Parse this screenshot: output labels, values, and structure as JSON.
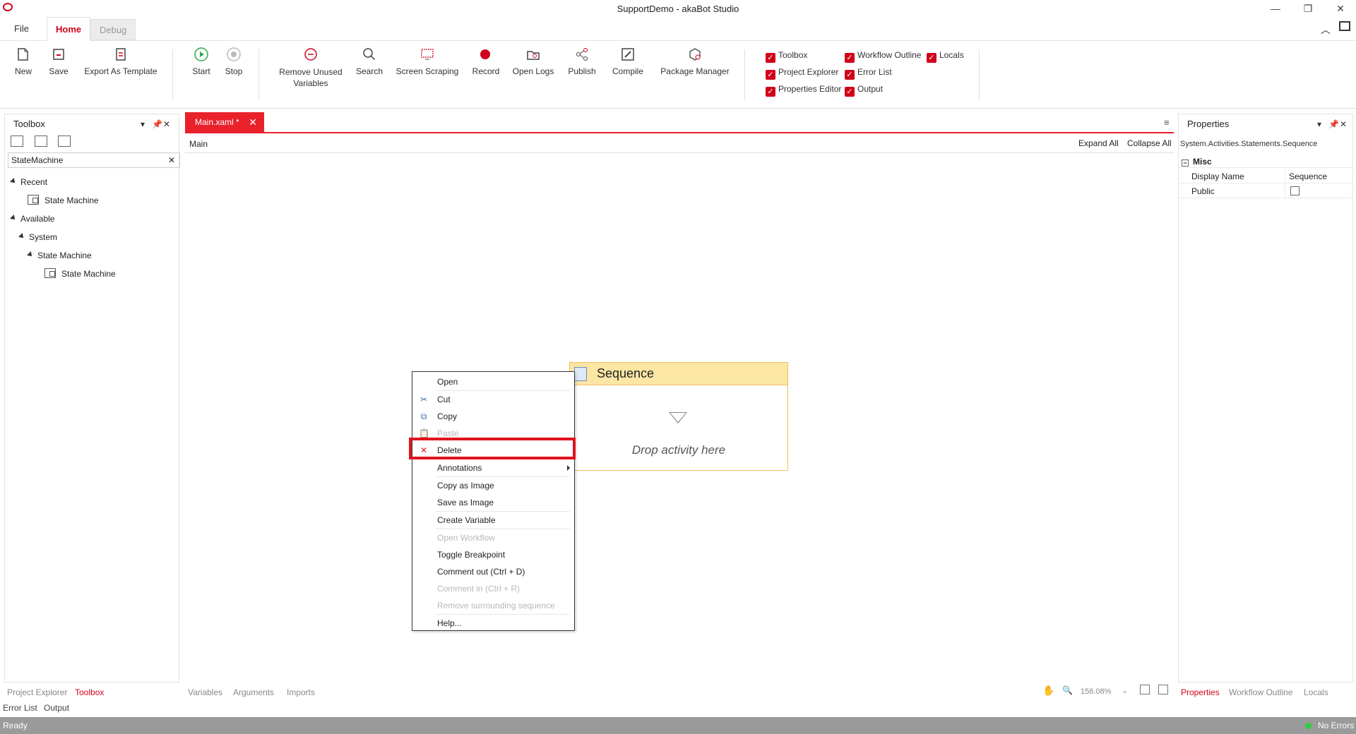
{
  "window": {
    "title": "SupportDemo - akaBot Studio"
  },
  "ribbon_tabs": {
    "file": "File",
    "home": "Home",
    "debug": "Debug"
  },
  "ribbon": {
    "new": "New",
    "save": "Save",
    "export_template": "Export As Template",
    "start": "Start",
    "stop": "Stop",
    "remove_unused_1": "Remove Unused",
    "remove_unused_2": "Variables",
    "search": "Search",
    "screen_scraping": "Screen Scraping",
    "record": "Record",
    "open_logs": "Open Logs",
    "publish": "Publish",
    "compile": "Compile",
    "package_manager": "Package Manager",
    "checks": {
      "toolbox": "Toolbox",
      "project_explorer": "Project Explorer",
      "properties_editor": "Properties Editor",
      "workflow_outline": "Workflow Outline",
      "error_list": "Error List",
      "output": "Output",
      "locals": "Locals"
    }
  },
  "toolbox": {
    "title": "Toolbox",
    "search_value": "StateMachine",
    "recent": "Recent",
    "recent_item": "State Machine",
    "available": "Available",
    "system": "System",
    "state_machine_group": "State Machine",
    "state_machine_item": "State Machine"
  },
  "left_bottom_tabs": {
    "project_explorer": "Project Explorer",
    "toolbox": "Toolbox",
    "error_list": "Error List",
    "output": "Output"
  },
  "document": {
    "tab_label": "Main.xaml *",
    "breadcrumb": "Main",
    "expand_all": "Expand All",
    "collapse_all": "Collapse All",
    "bottom_tabs": {
      "variables": "Variables",
      "arguments": "Arguments",
      "imports": "Imports"
    },
    "zoom": "156.08%"
  },
  "sequence": {
    "title": "Sequence",
    "drop_text": "Drop activity here"
  },
  "context_menu": {
    "open": "Open",
    "cut": "Cut",
    "copy": "Copy",
    "paste": "Paste",
    "delete": "Delete",
    "annotations": "Annotations",
    "copy_as_image": "Copy as Image",
    "save_as_image": "Save as Image",
    "create_variable": "Create Variable",
    "open_workflow": "Open Workflow",
    "toggle_breakpoint": "Toggle Breakpoint",
    "comment_out": "Comment out (Ctrl + D)",
    "comment_in": "Comment in (Ctrl + R)",
    "remove_surrounding": "Remove surrounding sequence",
    "help": "Help..."
  },
  "properties": {
    "title": "Properties",
    "type_name": "System.Activities.Statements.Sequence",
    "category": "Misc",
    "display_name_label": "Display Name",
    "display_name_value": "Sequence",
    "public_label": "Public"
  },
  "right_bottom_tabs": {
    "properties": "Properties",
    "workflow_outline": "Workflow Outline",
    "locals": "Locals"
  },
  "status": {
    "left": "Ready",
    "right": "No Errors"
  },
  "colors": {
    "accent": "#e8212b",
    "sequence_header": "#fbe6a3",
    "status_ok": "#2ecc40"
  }
}
